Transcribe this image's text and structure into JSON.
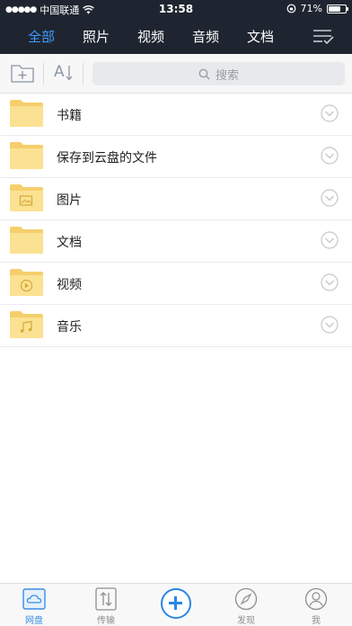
{
  "status_bar": {
    "carrier": "中国联通",
    "time": "13:58",
    "battery": "71%",
    "battery_level": 0.71
  },
  "nav": {
    "tabs": [
      "全部",
      "照片",
      "视频",
      "音频",
      "文档"
    ],
    "active_index": 0
  },
  "toolbar": {
    "sort_label": "A",
    "search_placeholder": "搜索"
  },
  "files": [
    {
      "name": "书籍",
      "icon": "folder-icon"
    },
    {
      "name": "保存到云盘的文件",
      "icon": "folder-icon"
    },
    {
      "name": "图片",
      "icon": "image-folder-icon"
    },
    {
      "name": "文档",
      "icon": "folder-icon"
    },
    {
      "name": "视频",
      "icon": "video-folder-icon"
    },
    {
      "name": "音乐",
      "icon": "music-folder-icon"
    }
  ],
  "bottom_tabs": {
    "netdisk": "网盘",
    "transfer": "传输",
    "discover": "发现",
    "me": "我"
  },
  "colors": {
    "header_bg": "#1f2530",
    "accent": "#3d9aff",
    "folder": "#fbe192"
  }
}
